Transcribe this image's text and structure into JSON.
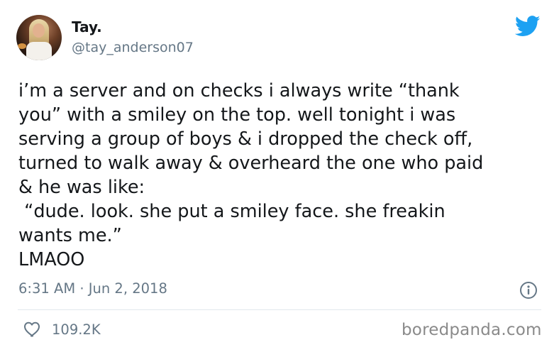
{
  "tweet": {
    "display_name": "Tay.",
    "handle": "@tay_anderson07",
    "text": "i’m a server and on checks i always write “thank\nyou” with a smiley on the top. well tonight i was\nserving a group of boys & i dropped the check off,\nturned to walk away & overheard the one who paid\n& he was like:\n “dude. look. she put a smiley face. she freakin\nwants me.”\nLMAOO",
    "timestamp": "6:31 AM · Jun 2, 2018",
    "likes": "109.2K"
  },
  "watermark": "boredpanda.com",
  "icons": {
    "logo": "twitter-bird-icon",
    "info": "info-icon",
    "like": "heart-icon"
  },
  "colors": {
    "brand": "#1da1f2",
    "secondary_text": "#657786",
    "primary_text": "#14171a",
    "divider": "#e1e8ed"
  }
}
